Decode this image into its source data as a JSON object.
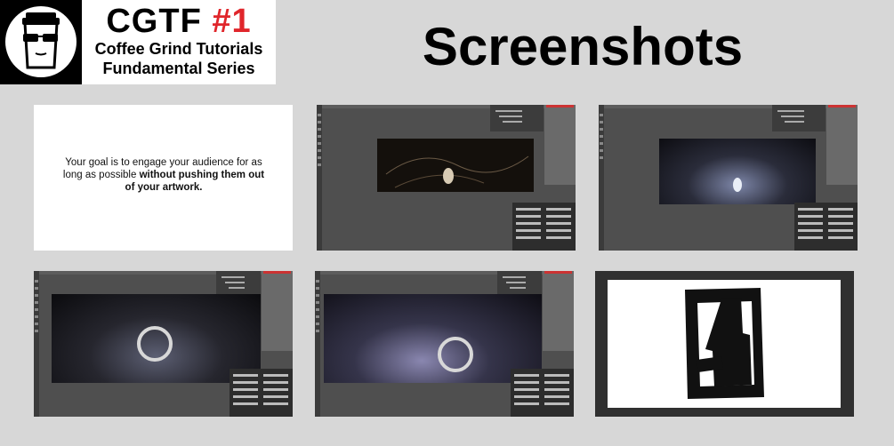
{
  "logo": {
    "icon": "coffee-cup-with-sunglasses-icon"
  },
  "brand": {
    "title_main": "CGTF",
    "title_num": " #1",
    "line1": "Coffee Grind Tutorials",
    "line2": "Fundamental Series"
  },
  "heading": "Screenshots",
  "slide": {
    "text_before": "Your goal is to engage your audience for as long as possible ",
    "text_bold": "without pushing them out of your artwork."
  },
  "colors": {
    "background": "#d7d7d7",
    "accent": "#e0262b",
    "ps_bg": "#4f4f4f",
    "ring": "#d8d8d8"
  },
  "thumbnails": [
    {
      "kind": "text-slide"
    },
    {
      "kind": "photoshop-sketch"
    },
    {
      "kind": "photoshop-painting"
    },
    {
      "kind": "photoshop-painting-ring"
    },
    {
      "kind": "photoshop-painting-ring"
    },
    {
      "kind": "silhouette-mask"
    }
  ]
}
